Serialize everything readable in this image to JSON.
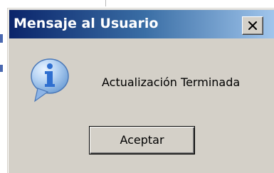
{
  "dialog": {
    "title": "Mensaje al Usuario",
    "message": "Actualización Terminada",
    "icon": "info-icon",
    "ok_label": "Aceptar",
    "close_icon": "close-icon"
  },
  "colors": {
    "titlebar_start": "#0a246a",
    "titlebar_end": "#a6caf0",
    "dialog_face": "#d4d0c8",
    "icon_fill": "#2f6fd0"
  }
}
